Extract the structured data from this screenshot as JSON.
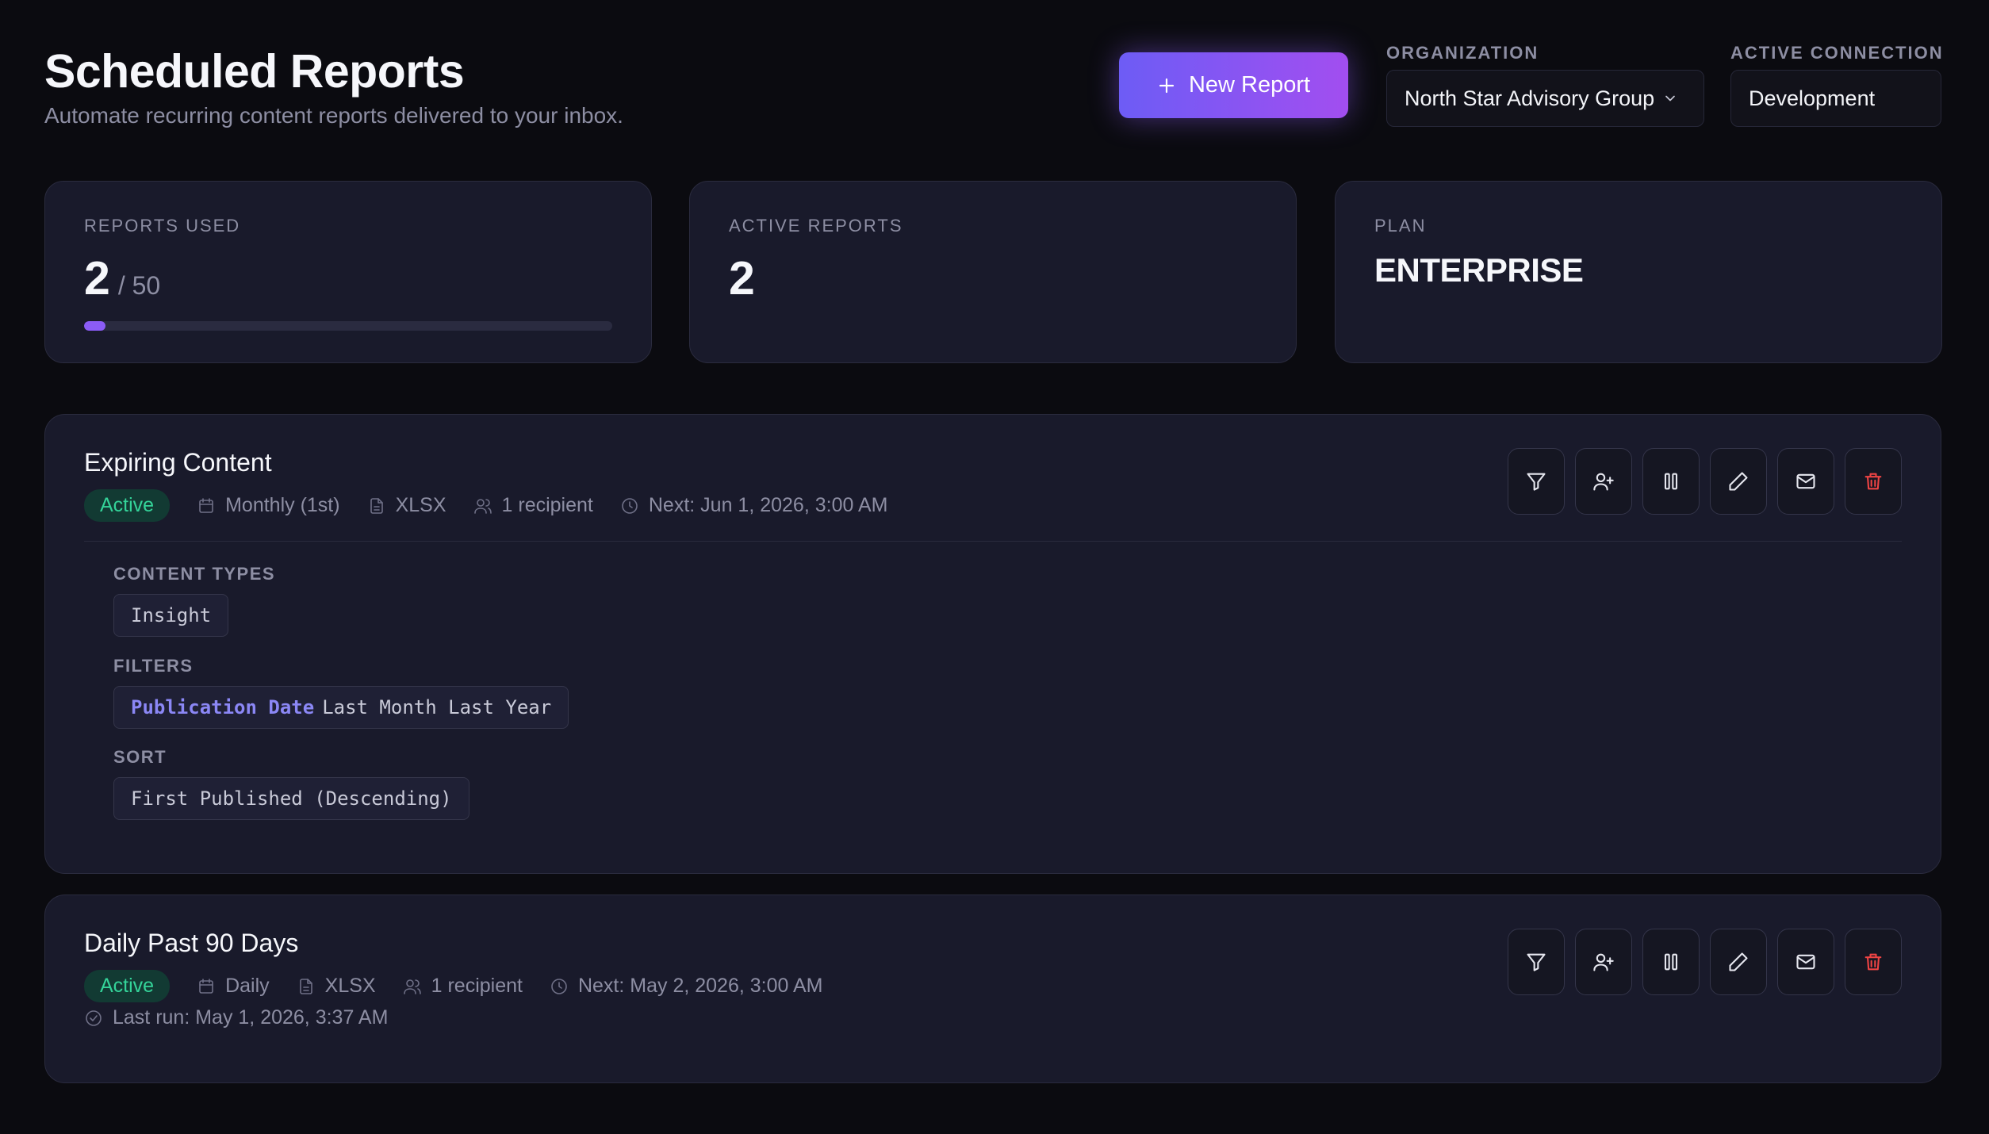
{
  "header": {
    "title": "Scheduled Reports",
    "subtitle": "Automate recurring content reports delivered to your inbox.",
    "new_report_label": "New Report",
    "organization_label": "ORGANIZATION",
    "organization_value": "North Star Advisory Group",
    "connection_label": "ACTIVE CONNECTION",
    "connection_value": "Development"
  },
  "stats": {
    "reports_used_label": "REPORTS USED",
    "reports_used_value": "2",
    "reports_used_limit": "/ 50",
    "reports_used_fraction": 0.04,
    "active_reports_label": "ACTIVE REPORTS",
    "active_reports_value": "2",
    "plan_label": "PLAN",
    "plan_value": "ENTERPRISE"
  },
  "reports": [
    {
      "name": "Expiring Content",
      "status": "Active",
      "schedule": "Monthly (1st)",
      "format": "XLSX",
      "recipients": "1 recipient",
      "next_run": "Next: Jun 1, 2026, 3:00 AM",
      "content_types_label": "CONTENT TYPES",
      "content_type": "Insight",
      "filters_label": "FILTERS",
      "filter_field": "Publication Date",
      "filter_value": "Last Month Last Year",
      "sort_label": "SORT",
      "sort_value": "First Published (Descending)"
    },
    {
      "name": "Daily Past 90 Days",
      "status": "Active",
      "schedule": "Daily",
      "format": "XLSX",
      "recipients": "1 recipient",
      "next_run": "Next: May 2, 2026, 3:00 AM",
      "last_run": "Last run: May 1, 2026, 3:37 AM"
    }
  ],
  "colors": {
    "background": "#0b0b10",
    "card": "#191a2b",
    "accent_start": "#6d5cf5",
    "accent_end": "#a24ef0",
    "active_green": "#34d399",
    "delete_red": "#ef4444"
  }
}
